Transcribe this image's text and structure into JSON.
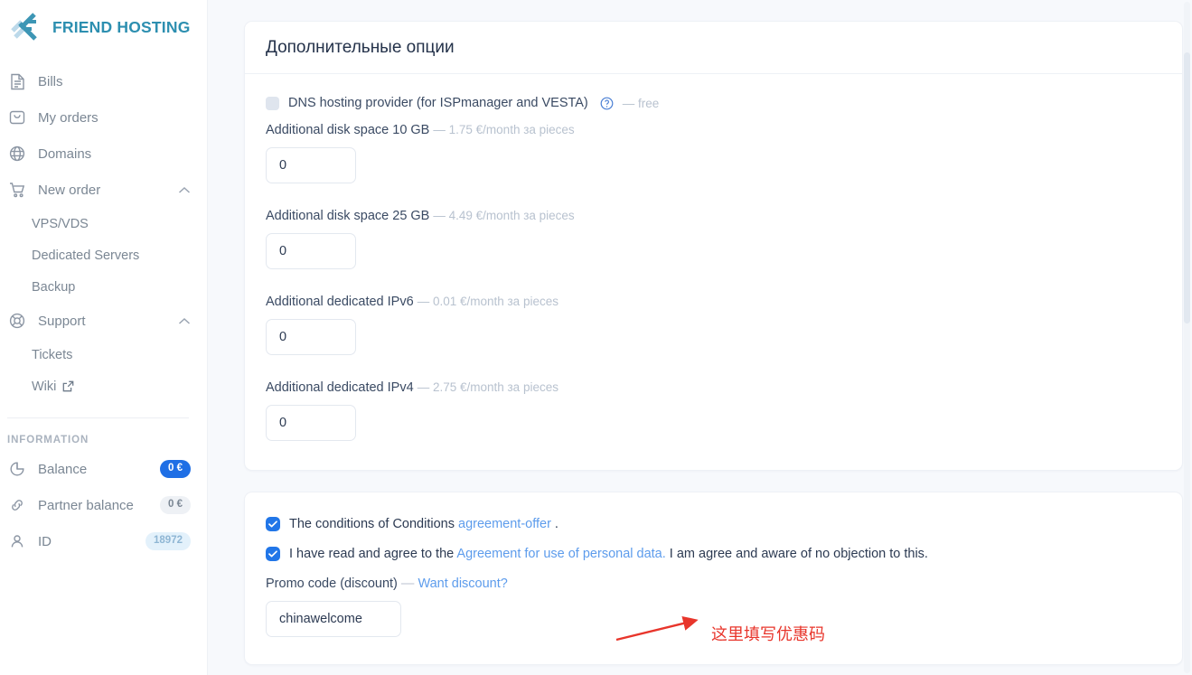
{
  "brand": {
    "name": "FRIEND HOSTING",
    "accent": "#2d8fb0"
  },
  "sidebar": {
    "nav": [
      {
        "label": "Bills",
        "icon": "document-icon"
      },
      {
        "label": "My orders",
        "icon": "bag-icon"
      },
      {
        "label": "Domains",
        "icon": "globe-icon"
      }
    ],
    "new_order": {
      "label": "New order",
      "icon": "cart-icon",
      "chevron": "chevron-up-icon"
    },
    "new_order_children": [
      {
        "label": "VPS/VDS"
      },
      {
        "label": "Dedicated Servers"
      },
      {
        "label": "Backup"
      }
    ],
    "support": {
      "label": "Support",
      "icon": "lifebuoy-icon",
      "chevron": "chevron-up-icon"
    },
    "support_children": [
      {
        "label": "Tickets",
        "external": false
      },
      {
        "label": "Wiki",
        "external": true
      }
    ],
    "information_title": "INFORMATION",
    "information": [
      {
        "label": "Balance",
        "icon": "pie-chart-icon",
        "badge": "0 €",
        "badge_style": "primary"
      },
      {
        "label": "Partner balance",
        "icon": "link-icon",
        "badge": "0 €",
        "badge_style": "muted"
      },
      {
        "label": "ID",
        "icon": "user-icon",
        "badge": "18972",
        "badge_style": "light"
      }
    ]
  },
  "options_card": {
    "title": "Дополнительные опции",
    "dns": {
      "label": "DNS hosting provider (for ISPmanager and VESTA)",
      "help_icon": "question-circle-icon",
      "price": "— free",
      "checked": false
    },
    "items": [
      {
        "label": "Additional disk space 10 GB",
        "price": "— 1.75 €/month за pieces",
        "value": "0"
      },
      {
        "label": "Additional disk space 25 GB",
        "price": "— 4.49 €/month за pieces",
        "value": "0"
      },
      {
        "label": "Additional dedicated IPv6",
        "price": "— 0.01 €/month за pieces",
        "value": "0"
      },
      {
        "label": "Additional dedicated IPv4",
        "price": "— 2.75 €/month за pieces",
        "value": "0"
      }
    ]
  },
  "agreement_card": {
    "terms": {
      "prefix": "The conditions of Conditions ",
      "link": "agreement-offer",
      "suffix": " .",
      "checked": true
    },
    "personal_data": {
      "prefix": "I have read and agree to the ",
      "link": "Agreement for use of personal data.",
      "suffix": " I am agree and aware of no objection to this.",
      "checked": true
    },
    "promo": {
      "label": "Promo code (discount)",
      "dash": " — ",
      "link": "Want discount?",
      "value": "chinawelcome",
      "placeholder": ""
    }
  },
  "annotation": {
    "text": "这里填写优惠码",
    "color": "#e8352b",
    "arrow": "red-arrow-pointing-right"
  }
}
